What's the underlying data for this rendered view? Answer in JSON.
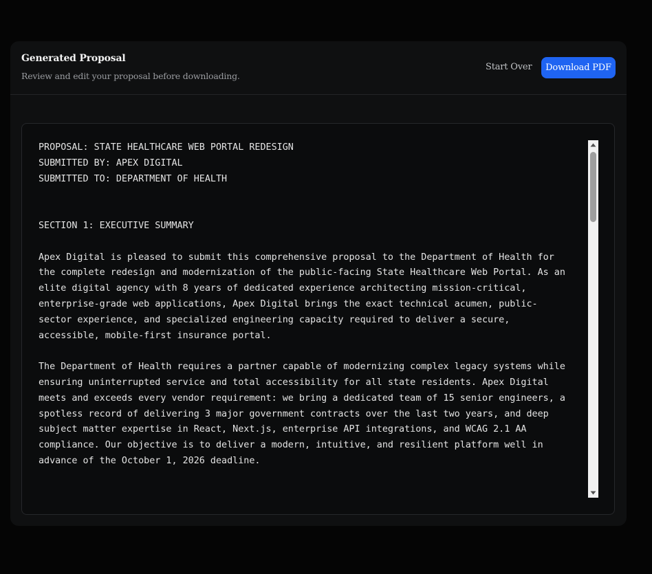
{
  "header": {
    "title": "Generated Proposal",
    "subtitle": "Review and edit your proposal before downloading.",
    "start_over_label": "Start Over",
    "download_label": "Download PDF"
  },
  "editor": {
    "content": "PROPOSAL: STATE HEALTHCARE WEB PORTAL REDESIGN\nSUBMITTED BY: APEX DIGITAL\nSUBMITTED TO: DEPARTMENT OF HEALTH\n\n\nSECTION 1: EXECUTIVE SUMMARY\n\nApex Digital is pleased to submit this comprehensive proposal to the Department of Health for\nthe complete redesign and modernization of the public-facing State Healthcare Web Portal. As an\nelite digital agency with 8 years of dedicated experience architecting mission-critical,\nenterprise-grade web applications, Apex Digital brings the exact technical acumen, public-\nsector experience, and specialized engineering capacity required to deliver a secure,\naccessible, mobile-first insurance portal.\n\nThe Department of Health requires a partner capable of modernizing complex legacy systems while\nensuring uninterrupted service and total accessibility for all state residents. Apex Digital\nmeets and exceeds every vendor requirement: we bring a dedicated team of 15 senior engineers, a\nspotless record of delivering 3 major government contracts over the last two years, and deep\nsubject matter expertise in React, Next.js, enterprise API integrations, and WCAG 2.1 AA\ncompliance. Our objective is to deliver a modern, intuitive, and resilient platform well in\nadvance of the October 1, 2026 deadline."
  }
}
